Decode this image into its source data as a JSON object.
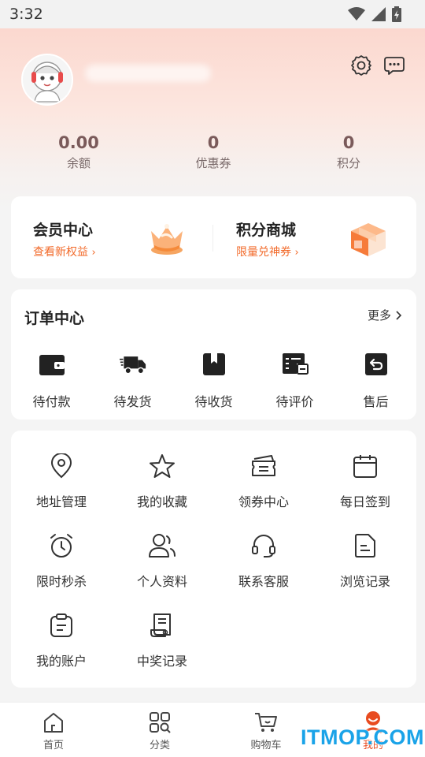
{
  "status_bar": {
    "time": "3:32"
  },
  "profile": {
    "settings_icon": "gear-icon",
    "message_icon": "chat-bubble-icon"
  },
  "stats": [
    {
      "value": "0.00",
      "label": "余额"
    },
    {
      "value": "0",
      "label": "优惠券"
    },
    {
      "value": "0",
      "label": "积分"
    }
  ],
  "member": {
    "left": {
      "title": "会员中心",
      "subtitle": "查看新权益"
    },
    "right": {
      "title": "积分商城",
      "subtitle": "限量兑神券"
    },
    "accent": "#f26a2a"
  },
  "orders": {
    "title": "订单中心",
    "more": "更多",
    "items": [
      {
        "label": "待付款",
        "icon": "wallet-icon"
      },
      {
        "label": "待发货",
        "icon": "truck-icon"
      },
      {
        "label": "待收货",
        "icon": "package-icon"
      },
      {
        "label": "待评价",
        "icon": "review-icon"
      },
      {
        "label": "售后",
        "icon": "return-icon"
      }
    ]
  },
  "services": [
    {
      "label": "地址管理",
      "icon": "location-pin-icon"
    },
    {
      "label": "我的收藏",
      "icon": "star-icon"
    },
    {
      "label": "领券中心",
      "icon": "ticket-icon"
    },
    {
      "label": "每日签到",
      "icon": "calendar-icon"
    },
    {
      "label": "限时秒杀",
      "icon": "alarm-clock-icon"
    },
    {
      "label": "个人资料",
      "icon": "user-profile-icon"
    },
    {
      "label": "联系客服",
      "icon": "headset-icon"
    },
    {
      "label": "浏览记录",
      "icon": "document-icon"
    },
    {
      "label": "我的账户",
      "icon": "clipboard-icon"
    },
    {
      "label": "中奖记录",
      "icon": "certificate-icon"
    }
  ],
  "tabbar": [
    {
      "label": "首页",
      "icon": "home-icon"
    },
    {
      "label": "分类",
      "icon": "grid-search-icon"
    },
    {
      "label": "购物车",
      "icon": "cart-icon"
    },
    {
      "label": "我的",
      "icon": "user-active-icon",
      "active": true
    }
  ],
  "watermark": "ITMOP.COM"
}
